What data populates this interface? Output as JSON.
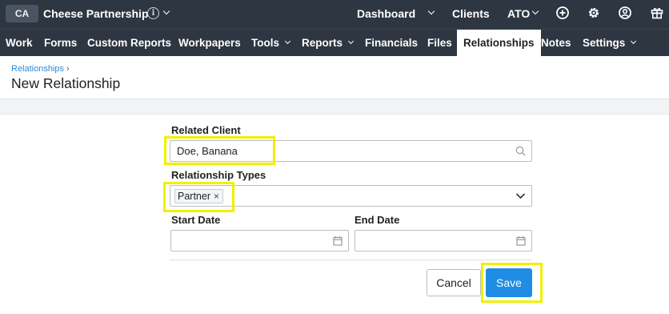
{
  "topbar": {
    "client_initials": "CA",
    "client_name": "Cheese Partnership",
    "info_glyph": "i",
    "links": {
      "dashboard": "Dashboard",
      "clients": "Clients",
      "ato": "ATO"
    },
    "icons": [
      "add-circle-icon",
      "gear-icon",
      "user-account-icon",
      "gift-icon"
    ]
  },
  "nav": {
    "work": "Work",
    "forms": "Forms",
    "custom_reports": "Custom Reports",
    "workpapers": "Workpapers",
    "tools": "Tools",
    "reports": "Reports",
    "financials": "Financials",
    "files": "Files",
    "relationships": "Relationships",
    "notes": "Notes",
    "settings": "Settings",
    "active": "Relationships"
  },
  "header": {
    "breadcrumb": "Relationships",
    "breadcrumb_sep": "›",
    "title": "New Relationship"
  },
  "form": {
    "related_client_label": "Related Client",
    "related_client_value": "Doe, Banana",
    "relationship_types_label": "Relationship Types",
    "relationship_type_tag": "Partner",
    "tag_remove": "×",
    "start_date_label": "Start Date",
    "start_date_value": "",
    "end_date_label": "End Date",
    "end_date_value": ""
  },
  "actions": {
    "cancel": "Cancel",
    "save": "Save"
  },
  "colors": {
    "topbar": "#2e3641",
    "active_tab_bg": "#ffffff",
    "link": "#2a8ad8",
    "primary_button": "#1f8de3",
    "highlight": "#f0f000"
  }
}
